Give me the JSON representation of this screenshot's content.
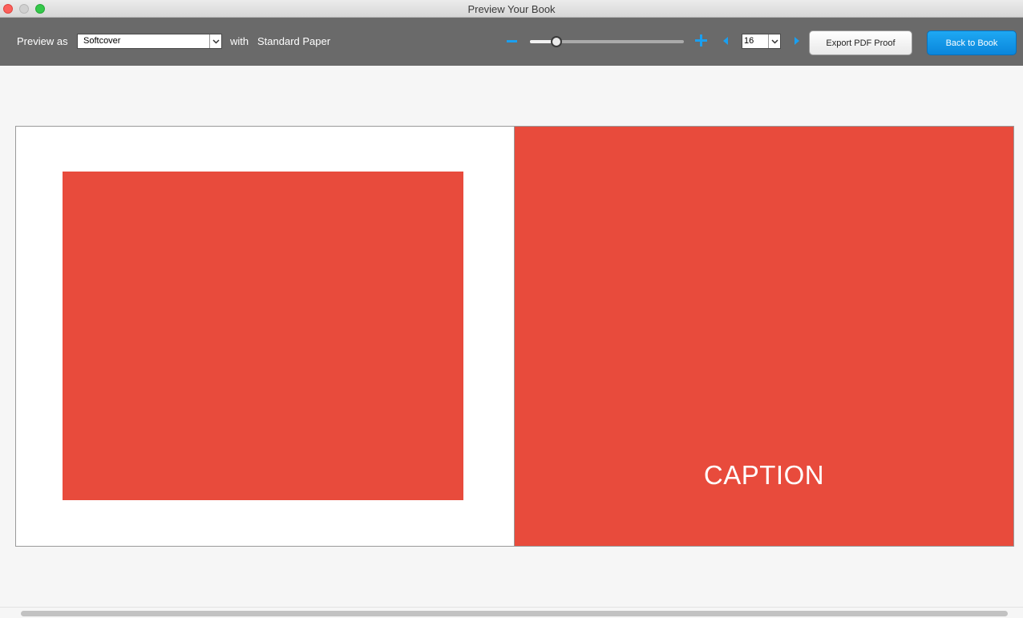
{
  "window": {
    "title": "Preview Your Book"
  },
  "toolbar": {
    "preview_label": "Preview as",
    "cover_select": {
      "value": "Softcover"
    },
    "with_label": "with",
    "paper_label": "Standard Paper",
    "zoom": {
      "level_fraction": 0.17
    },
    "page_select": {
      "value": "16"
    },
    "export_button": "Export PDF Proof",
    "back_button": "Back to Book"
  },
  "spread": {
    "right_page": {
      "caption": "CAPTION"
    }
  },
  "colors": {
    "accent": "#1a9ff0",
    "page_fill": "#e84b3c",
    "toolbar": "#6a6a6a"
  },
  "icons": {
    "zoom_out": "minus-icon",
    "zoom_in": "plus-icon",
    "prev_page": "chevron-left-icon",
    "next_page": "chevron-right-icon",
    "dropdown": "chevron-down-icon"
  }
}
